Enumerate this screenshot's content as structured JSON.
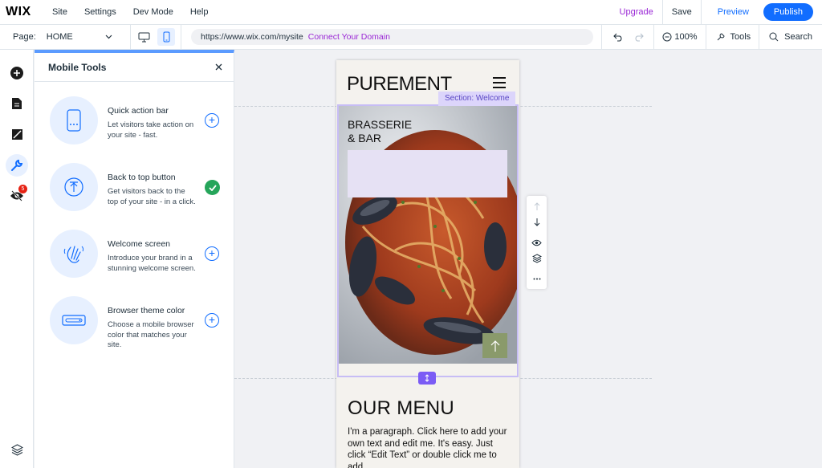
{
  "topbar": {
    "logo": "WIX",
    "menu": [
      "Site",
      "Settings",
      "Dev Mode",
      "Help"
    ],
    "upgrade": "Upgrade",
    "save": "Save",
    "preview": "Preview",
    "publish": "Publish"
  },
  "secondbar": {
    "page_label": "Page:",
    "page_value": "HOME",
    "url": "https://www.wix.com/mysite",
    "connect_domain": "Connect Your Domain",
    "zoom": "100%",
    "tools": "Tools",
    "search": "Search"
  },
  "rail": {
    "badge_count": "5"
  },
  "panel": {
    "title": "Mobile Tools",
    "tools": [
      {
        "title": "Quick action bar",
        "desc": "Let visitors take action on your site - fast.",
        "state": "add"
      },
      {
        "title": "Back to top button",
        "desc": "Get visitors back to the top of your site - in a click.",
        "state": "added"
      },
      {
        "title": "Welcome screen",
        "desc": "Introduce your brand in a stunning welcome screen.",
        "state": "add"
      },
      {
        "title": "Browser theme color",
        "desc": "Choose a mobile browser color that matches your site.",
        "state": "add"
      }
    ]
  },
  "site": {
    "brand": "PUREMENT",
    "section_label": "Section: Welcome",
    "hero_title_line1": "BRASSERIE",
    "hero_title_line2": "& BAR",
    "menu_title": "OUR MENU",
    "menu_paragraph": "I'm a paragraph. Click here to add your own text and edit me. It's easy. Just click “Edit Text” or double click me to add"
  },
  "colors": {
    "accent": "#116dff",
    "upgrade": "#9a27d5",
    "section": "#7b5cf5",
    "success": "#25a55a"
  }
}
